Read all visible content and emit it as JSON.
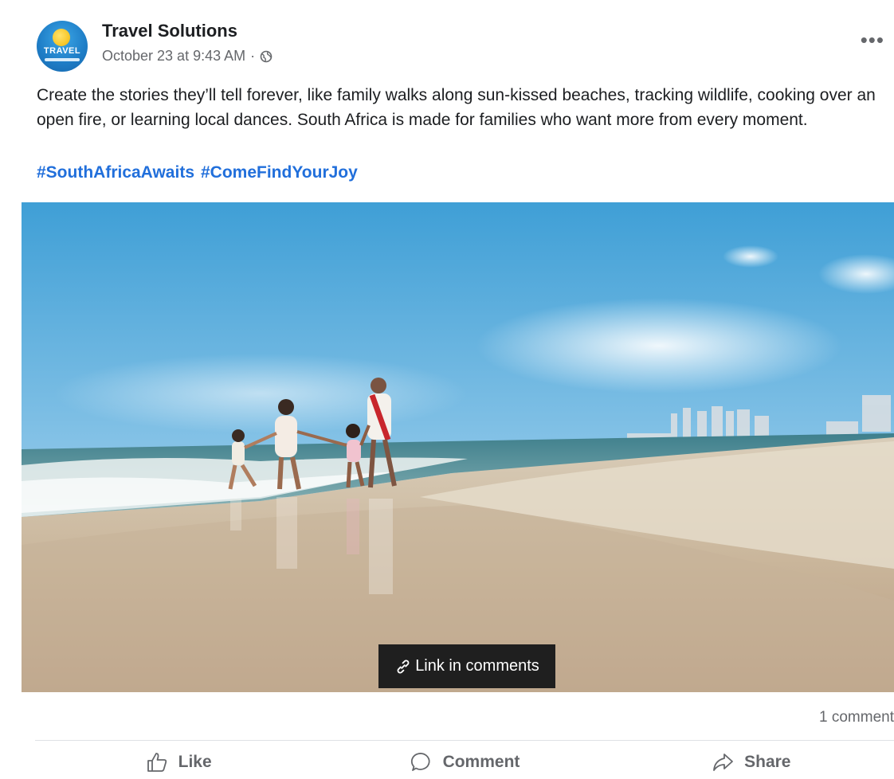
{
  "post": {
    "page_name": "Travel Solutions",
    "avatar_text": "TRAVEL",
    "timestamp": "October 23 at 9:43 AM",
    "separator": "·",
    "more_label": "•••",
    "body": "Create the stories they’ll tell forever, like family walks along sun-kissed beaches, tracking wildlife, cooking over an open fire, or learning local dances. South Africa is made for families who want more from every moment.",
    "hashtags": [
      "#SouthAfricaAwaits",
      "#ComeFindYourJoy"
    ]
  },
  "media": {
    "badge_label": "Link in comments"
  },
  "stats": {
    "comments": "1 comment"
  },
  "actions": {
    "like": "Like",
    "comment": "Comment",
    "share": "Share"
  },
  "colors": {
    "hashtag": "#216fdb",
    "meta_text": "#65676b",
    "badge_bg": "#1f1f1f"
  }
}
